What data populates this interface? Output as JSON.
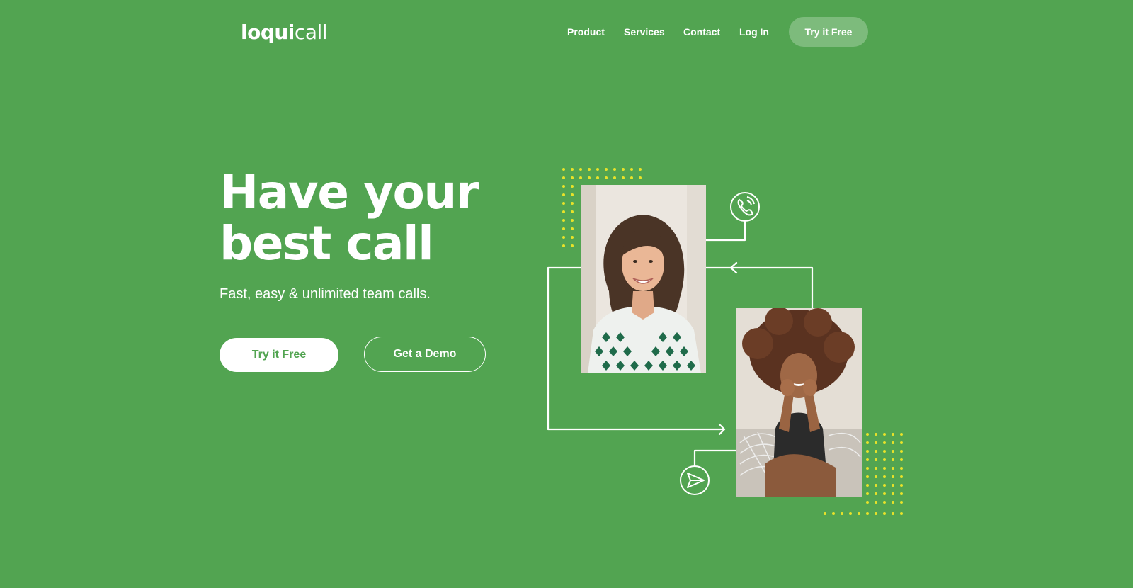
{
  "brand": {
    "logo_strong": "loqui",
    "logo_light": "call"
  },
  "nav": {
    "items": [
      {
        "label": "Product"
      },
      {
        "label": "Services"
      },
      {
        "label": "Contact"
      },
      {
        "label": "Log In"
      }
    ],
    "cta_label": "Try it Free"
  },
  "hero": {
    "headline_line1": "Have your",
    "headline_line2": "best call",
    "subheadline": "Fast, easy & unlimited team calls.",
    "primary_cta": "Try it Free",
    "secondary_cta": "Get a Demo"
  },
  "illustration": {
    "icons": [
      "phone-icon",
      "send-icon"
    ]
  },
  "colors": {
    "background": "#52a451",
    "accent_dots": "#e8e22a",
    "text": "#ffffff"
  }
}
